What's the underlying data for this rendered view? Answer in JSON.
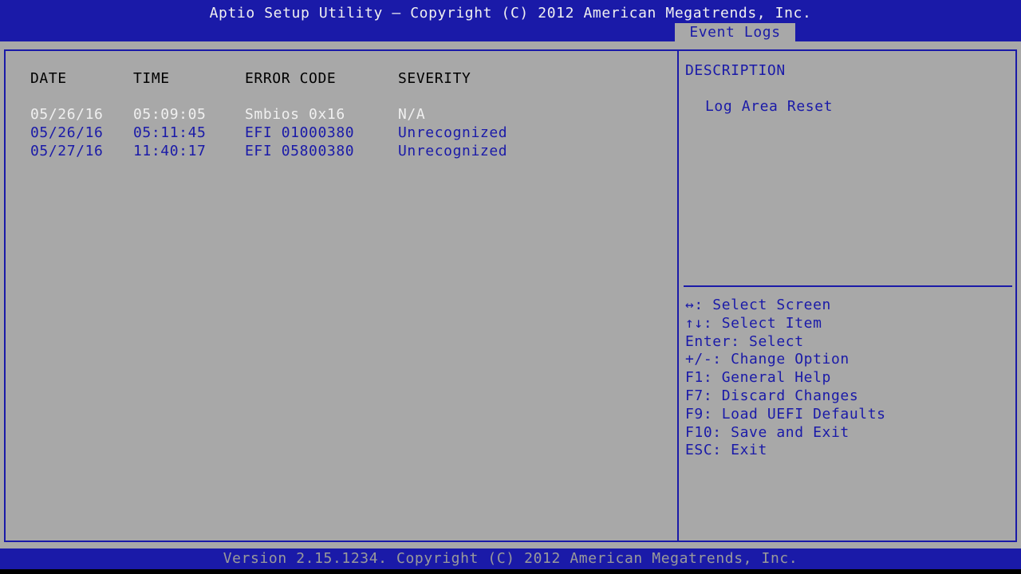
{
  "header": {
    "title": "Aptio Setup Utility – Copyright (C) 2012 American Megatrends, Inc.",
    "active_tab": "Event Logs"
  },
  "log_table": {
    "columns": [
      "DATE",
      "TIME",
      "ERROR CODE",
      "SEVERITY"
    ],
    "rows": [
      {
        "date": "05/26/16",
        "time": "05:09:05",
        "error_code": "Smbios 0x16",
        "severity": "N/A",
        "selected": true
      },
      {
        "date": "05/26/16",
        "time": "05:11:45",
        "error_code": "EFI 01000380",
        "severity": "Unrecognized",
        "selected": false
      },
      {
        "date": "05/27/16",
        "time": "11:40:17",
        "error_code": "EFI 05800380",
        "severity": "Unrecognized",
        "selected": false
      }
    ]
  },
  "help_panel": {
    "title": "DESCRIPTION",
    "description": "Log Area Reset",
    "keys": [
      "↔: Select Screen",
      "↑↓: Select Item",
      "Enter: Select",
      "+/-: Change Option",
      "F1: General Help",
      "F7: Discard Changes",
      "F9: Load UEFI Defaults",
      "F10: Save and Exit",
      "ESC: Exit"
    ]
  },
  "footer": {
    "version_text": "Version 2.15.1234. Copyright (C) 2012 American Megatrends, Inc."
  },
  "colors": {
    "bios_blue": "#1a1aa8",
    "panel_gray": "#a8a8a8",
    "highlight_white": "#f0f0f0"
  }
}
